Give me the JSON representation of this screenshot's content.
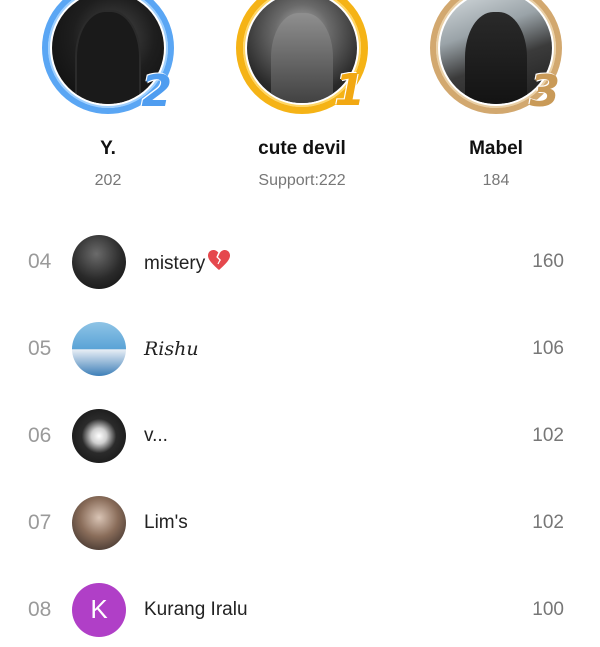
{
  "podium": [
    {
      "rank": "2",
      "name": "Y.",
      "score": "202"
    },
    {
      "rank": "1",
      "name": "cute devil",
      "score": "Support:222"
    },
    {
      "rank": "3",
      "name": "Mabel",
      "score": "184"
    }
  ],
  "list": [
    {
      "rank": "04",
      "name": "mistery",
      "score": "160",
      "icon": "broken-heart-icon"
    },
    {
      "rank": "05",
      "name": "Rishu",
      "score": "106"
    },
    {
      "rank": "06",
      "name": "v...",
      "score": "102"
    },
    {
      "rank": "07",
      "name": "Lim's",
      "score": "102"
    },
    {
      "rank": "08",
      "name": "Kurang Iralu",
      "score": "100",
      "avatar_letter": "K"
    }
  ],
  "colors": {
    "silver": "#5aa6f4",
    "gold": "#f5b316",
    "bronze": "#d2a86f",
    "avatar_purple": "#b03fc7",
    "crown_pink": "#f05a7a"
  }
}
